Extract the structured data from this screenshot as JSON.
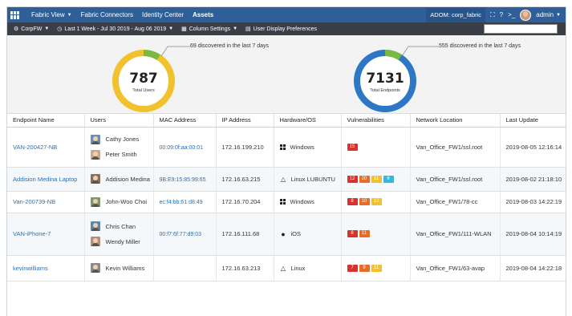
{
  "nav": {
    "items": [
      {
        "label": "Fabric View",
        "caret": true,
        "active": false
      },
      {
        "label": "Fabric Connectors",
        "caret": false,
        "active": false
      },
      {
        "label": "Identity Center",
        "caret": false,
        "active": false
      },
      {
        "label": "Assets",
        "caret": false,
        "active": true
      }
    ],
    "adom": "ADOM: corp_fabric",
    "user": "admin",
    "icons": [
      "apps-grid-icon",
      "fullscreen-icon",
      "help-icon",
      "terminal-icon"
    ]
  },
  "toolbar": {
    "device": "CorpFW",
    "time_range": "Last 1 Week - Jul 30 2019 - Aug 06 2019",
    "column_settings": "Column Settings",
    "display_prefs": "User Display Preferences",
    "search_placeholder": ""
  },
  "summary": {
    "users": {
      "total": "787",
      "label": "Total Users",
      "discovered": "69 discovered in the last 7 days",
      "color": "#f2c12e",
      "accent": "#7ab840"
    },
    "endpoints": {
      "total": "7131",
      "label": "Total Endpoints",
      "discovered": "555 discovered in the last 7 days",
      "color": "#2d77c4",
      "accent": "#7ab840"
    }
  },
  "table": {
    "columns": [
      "Endpoint Name",
      "Users",
      "MAC Address",
      "IP Address",
      "Hardware/OS",
      "Vulnerabilities",
      "Network Location",
      "Last Update"
    ],
    "rows": [
      {
        "endpoint": "VAN-200427-NB",
        "users": [
          {
            "name": "Cathy Jones",
            "avatar": "#6a8fb0"
          },
          {
            "name": "Peter Smith",
            "avatar": "#c9a88d"
          }
        ],
        "mac": "00:09:0f:aa:00:01",
        "ip": "172.16.199.210",
        "os": "Windows",
        "os_icon": "windows-icon",
        "vulns": [
          {
            "count": "15",
            "color": "#d9312c"
          }
        ],
        "location": "Van_Office_FW1/ssl.root",
        "updated": "2019-08-05 12:16:14"
      },
      {
        "endpoint": "Addision Medina Laptop",
        "users": [
          {
            "name": "Addision Medina",
            "avatar": "#8c6e55"
          }
        ],
        "mac": "9B:E9:15:85:99:65",
        "ip": "172.16.63.215",
        "os": "Linux LUBUNTU",
        "os_icon": "linux-icon",
        "vulns": [
          {
            "count": "12",
            "color": "#d9312c"
          },
          {
            "count": "20",
            "color": "#e76c2a"
          },
          {
            "count": "11",
            "color": "#f2c12e"
          },
          {
            "count": "6",
            "color": "#3bb5d8"
          }
        ],
        "location": "Van_Office_FW1/ssl.root",
        "updated": "2019-08-02 21:18:10"
      },
      {
        "endpoint": "Van-200739-NB",
        "users": [
          {
            "name": "John-Woo Choi",
            "avatar": "#7a9a6a"
          }
        ],
        "mac": "ec:f4:bb:61:d8:49",
        "ip": "172.16.70.204",
        "os": "Windows",
        "os_icon": "windows-icon",
        "vulns": [
          {
            "count": "8",
            "color": "#d9312c"
          },
          {
            "count": "10",
            "color": "#e76c2a"
          },
          {
            "count": "12",
            "color": "#f2c12e"
          }
        ],
        "location": "Van_Office_FW1/78-cc",
        "updated": "2019-08-03 14:22:19"
      },
      {
        "endpoint": "VAN-iPhone-7",
        "users": [
          {
            "name": "Chris Chan",
            "avatar": "#5b86a8"
          },
          {
            "name": "Wendy Miller",
            "avatar": "#b38e7a"
          }
        ],
        "mac": "00:f7:6f:77:d9:03",
        "ip": "172.16.111.68",
        "os": "iOS",
        "os_icon": "apple-icon",
        "vulns": [
          {
            "count": "8",
            "color": "#d9312c"
          },
          {
            "count": "11",
            "color": "#e76c2a"
          }
        ],
        "location": "Van_Office_FW1/111-WLAN",
        "updated": "2019-08-04 10:14:19"
      },
      {
        "endpoint": "kevinwilliams",
        "users": [
          {
            "name": "Kevin Williams",
            "avatar": "#8a8a8a"
          }
        ],
        "mac": "",
        "ip": "172.16.63.213",
        "os": "Linux",
        "os_icon": "linux-icon",
        "vulns": [
          {
            "count": "7",
            "color": "#d9312c"
          },
          {
            "count": "9",
            "color": "#e76c2a"
          },
          {
            "count": "11",
            "color": "#f2c12e"
          }
        ],
        "location": "Van_Office_FW1/63-avap",
        "updated": "2019-08-04 14:22:18"
      }
    ]
  }
}
